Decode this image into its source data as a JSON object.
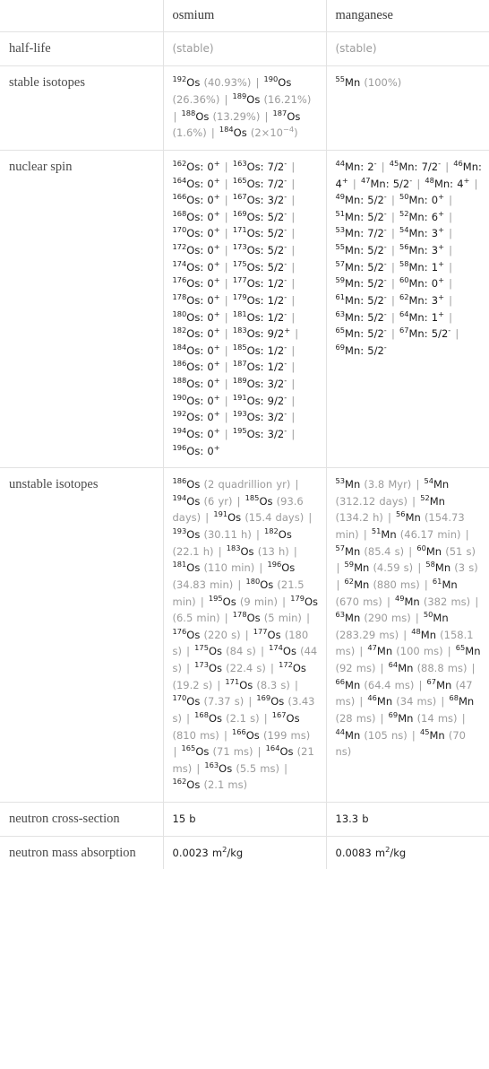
{
  "table": {
    "columns": [
      "",
      "osmium",
      "manganese"
    ],
    "rows": [
      {
        "label": "half-life",
        "osmium": "(stable)",
        "manganese": "(stable)",
        "style": "muted"
      },
      {
        "label": "stable isotopes",
        "osmium": "192Os (40.93%) | 190Os (26.36%) | 189Os (16.21%) | 188Os (13.29%) | 187Os (1.6%) | 184Os (2×10^-4)",
        "manganese": "55Mn (100%)"
      },
      {
        "label": "nuclear spin",
        "osmium": "162Os: 0+ | 163Os: 7/2- | 164Os: 0+ | 165Os: 7/2- | 166Os: 0+ | 167Os: 3/2- | 168Os: 0+ | 169Os: 5/2- | 170Os: 0+ | 171Os: 5/2- | 172Os: 0+ | 173Os: 5/2- | 174Os: 0+ | 175Os: 5/2- | 176Os: 0+ | 177Os: 1/2- | 178Os: 0+ | 179Os: 1/2- | 180Os: 0+ | 181Os: 1/2- | 182Os: 0+ | 183Os: 9/2+ | 184Os: 0+ | 185Os: 1/2- | 186Os: 0+ | 187Os: 1/2- | 188Os: 0+ | 189Os: 3/2- | 190Os: 0+ | 191Os: 9/2- | 192Os: 0+ | 193Os: 3/2- | 194Os: 0+ | 195Os: 3/2- | 196Os: 0+",
        "manganese": "44Mn: 2- | 45Mn: 7/2- | 46Mn: 4+ | 47Mn: 5/2- | 48Mn: 4+ | 49Mn: 5/2- | 50Mn: 0+ | 51Mn: 5/2- | 52Mn: 6+ | 53Mn: 7/2- | 54Mn: 3+ | 55Mn: 5/2- | 56Mn: 3+ | 57Mn: 5/2- | 58Mn: 1+ | 59Mn: 5/2- | 60Mn: 0+ | 61Mn: 5/2- | 62Mn: 3+ | 63Mn: 5/2- | 64Mn: 1+ | 65Mn: 5/2- | 67Mn: 5/2- | 69Mn: 5/2-"
      },
      {
        "label": "unstable isotopes",
        "osmium": "186Os (2 quadrillion yr) | 194Os (6 yr) | 185Os (93.6 days) | 191Os (15.4 days) | 193Os (30.11 h) | 182Os (22.1 h) | 183Os (13 h) | 181Os (110 min) | 196Os (34.83 min) | 180Os (21.5 min) | 195Os (9 min) | 179Os (6.5 min) | 178Os (5 min) | 176Os (220 s) | 177Os (180 s) | 175Os (84 s) | 174Os (44 s) | 173Os (22.4 s) | 172Os (19.2 s) | 171Os (8.3 s) | 170Os (7.37 s) | 169Os (3.43 s) | 168Os (2.1 s) | 167Os (810 ms) | 166Os (199 ms) | 165Os (71 ms) | 164Os (21 ms) | 163Os (5.5 ms) | 162Os (2.1 ms)",
        "manganese": "53Mn (3.8 Myr) | 54Mn (312.12 days) | 52Mn (134.2 h) | 56Mn (154.73 min) | 51Mn (46.17 min) | 57Mn (85.4 s) | 60Mn (51 s) | 59Mn (4.59 s) | 58Mn (3 s) | 62Mn (880 ms) | 61Mn (670 ms) | 49Mn (382 ms) | 63Mn (290 ms) | 50Mn (283.29 ms) | 48Mn (158.1 ms) | 47Mn (100 ms) | 65Mn (92 ms) | 64Mn (88.8 ms) | 66Mn (64.4 ms) | 67Mn (47 ms) | 46Mn (34 ms) | 68Mn (28 ms) | 69Mn (14 ms) | 44Mn (105 ns) | 45Mn (70 ns)"
      },
      {
        "label": "neutron cross-section",
        "osmium": "15 b",
        "manganese": "13.3 b"
      },
      {
        "label": "neutron mass absorption",
        "osmium": "0.0023 m2/kg",
        "manganese": "0.0083 m2/kg"
      }
    ]
  },
  "colors": {
    "border": "#e2e2e2",
    "text": "#1c1c1c",
    "muted": "#9b9b9b",
    "label": "#4a4a4a"
  }
}
